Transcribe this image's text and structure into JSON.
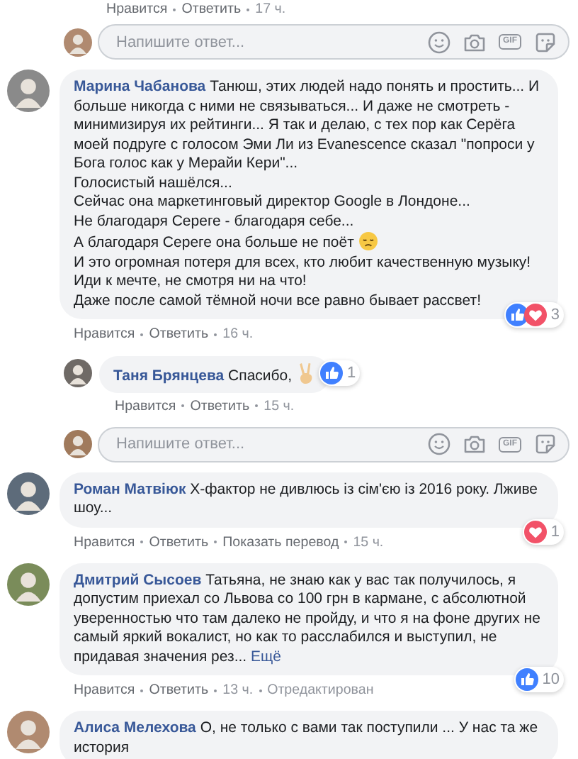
{
  "items": [
    {
      "kind": "actions",
      "actions": [
        {
          "label": "Нравится"
        },
        {
          "label": "Ответить"
        }
      ],
      "time": "17 ч."
    },
    {
      "kind": "composer",
      "placeholder": "Напишите ответ...",
      "gif": "GIF"
    },
    {
      "kind": "comment",
      "author": "Марина Чабанова",
      "paragraphs": [
        {
          "text": "Танюш, этих людей надо понять и простить... И больше никогда с ними не связываться... И даже не смотреть - минимизируя их рейтинги... Я так и делаю, с тех пор как Серёга моей подруге с голосом Эми Ли из Evanescence сказал \"попроси у Бога голос как у Мерайи Кери\"..."
        },
        {
          "text": "Голосистый нашёлся..."
        },
        {
          "text": "Сейчас она маркетинговый директор Google в Лондоне..."
        },
        {
          "text": "Не благодаря Сереге - благодаря себе..."
        },
        {
          "text": "А благодаря Сереге она больше не поёт",
          "emoji": {
            "kind": "sad"
          }
        },
        {
          "text": "И это огромная потеря для всех, кто любит качественную музыку!"
        },
        {
          "text": "Иди к мечте, не смотря ни на что!"
        },
        {
          "text": "Даже после самой тёмной ночи все равно бывает рассвет!"
        }
      ],
      "reactions": {
        "types": [
          {
            "kind": "like"
          },
          {
            "kind": "love"
          }
        ],
        "count": "3"
      },
      "actions": [
        {
          "label": "Нравится"
        },
        {
          "label": "Ответить"
        }
      ],
      "time": "16 ч."
    },
    {
      "kind": "reply",
      "author": "Таня Брянцева",
      "paragraphs": [
        {
          "text": "Спасибо,",
          "emoji": {
            "kind": "victory"
          }
        }
      ],
      "reactions": {
        "types": [
          {
            "kind": "like"
          }
        ],
        "count": "1"
      },
      "actions": [
        {
          "label": "Нравится"
        },
        {
          "label": "Ответить"
        }
      ],
      "time": "15 ч."
    },
    {
      "kind": "composer",
      "placeholder": "Напишите ответ...",
      "gif": "GIF"
    },
    {
      "kind": "comment",
      "author": "Роман Матвіюк",
      "paragraphs": [
        {
          "text": "X-фактор не дивлюсь із сім'єю із 2016 року. Лживе шоу..."
        }
      ],
      "reactions": {
        "types": [
          {
            "kind": "love"
          }
        ],
        "count": "1"
      },
      "actions": [
        {
          "label": "Нравится"
        },
        {
          "label": "Ответить"
        },
        {
          "label": "Показать перевод"
        }
      ],
      "time": "15 ч."
    },
    {
      "kind": "comment",
      "author": "Дмитрий Сысоев",
      "paragraphs": [
        {
          "text": "Татьяна, не знаю как у вас так получилось, я допустим приехал со Львова со 100 грн в кармане, с абсолютной уверенностью что там далеко не пройду, и что я на фоне других не самый яркий вокалист, но как то расслабился и выступил, не придавая значения рез..."
        }
      ],
      "more": "Ещё",
      "reactions": {
        "types": [
          {
            "kind": "like"
          }
        ],
        "count": "10"
      },
      "actions": [
        {
          "label": "Нравится"
        },
        {
          "label": "Ответить"
        }
      ],
      "time": "13 ч.",
      "edited": "Отредактирован"
    },
    {
      "kind": "comment",
      "author": "Алиса Мелехова",
      "paragraphs": [
        {
          "text": "О, не только с вами так поступили ... У нас та же история"
        }
      ]
    }
  ]
}
